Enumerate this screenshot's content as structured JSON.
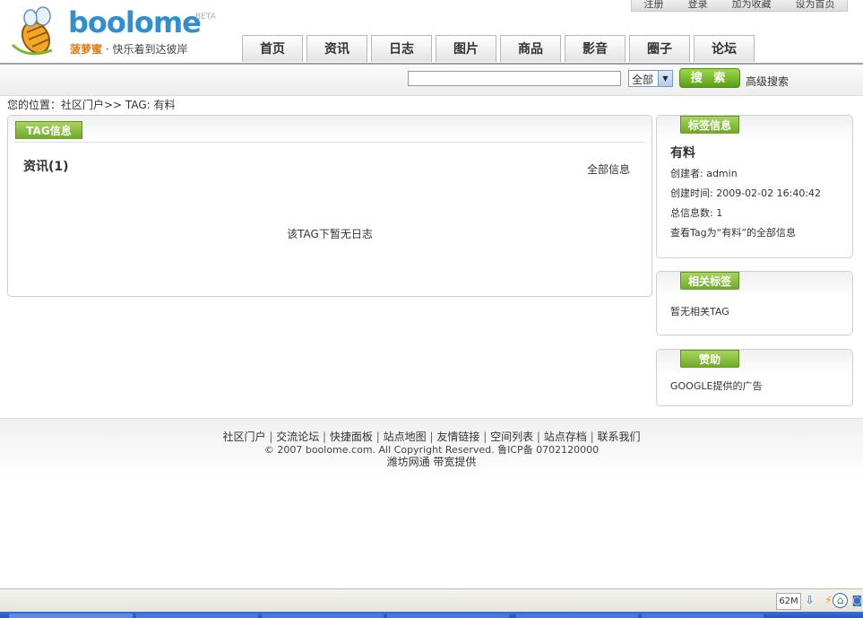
{
  "header": {
    "brand": "boolome",
    "beta": "BETA",
    "slogan_cn": "菠萝蜜",
    "slogan_rest": "· 快乐着到达彼岸",
    "top_links": [
      "注册",
      "登录",
      "加为收藏",
      "设为首页"
    ],
    "nav": [
      "首页",
      "资讯",
      "日志",
      "图片",
      "商品",
      "影音",
      "圈子",
      "论坛"
    ]
  },
  "search": {
    "input_value": "",
    "select_value": "全部",
    "button_label": "搜 索",
    "advanced": "高级搜索"
  },
  "breadcrumb": "您的位置：社区门户>> TAG: 有料",
  "main": {
    "tab": "TAG信息",
    "section_title": "资讯(1)",
    "all_info": "全部信息",
    "empty": "该TAG下暂无日志"
  },
  "tag_info": {
    "title": "标签信息",
    "name": "有料",
    "creator": "创建者: admin",
    "created": "创建时间: 2009-02-02 16:40:42",
    "total": "总信息数: 1",
    "view_all": "查看Tag为“有料”的全部信息"
  },
  "related": {
    "title": "相关标签",
    "empty": "暂无相关TAG"
  },
  "ad": {
    "title": "赞助",
    "text": "GOOGLE提供的广告"
  },
  "footer": {
    "links": [
      "社区门户",
      "交流论坛",
      "快捷面板",
      "站点地图",
      "友情链接",
      "空间列表",
      "站点存档",
      "联系我们"
    ],
    "copyright": "© 2007 boolome.com. All Copyright Reserved. 鲁ICP备 0702120000",
    "bandwidth": "潍坊网通 带宽提供"
  },
  "statusbar": {
    "memory": "62M"
  }
}
